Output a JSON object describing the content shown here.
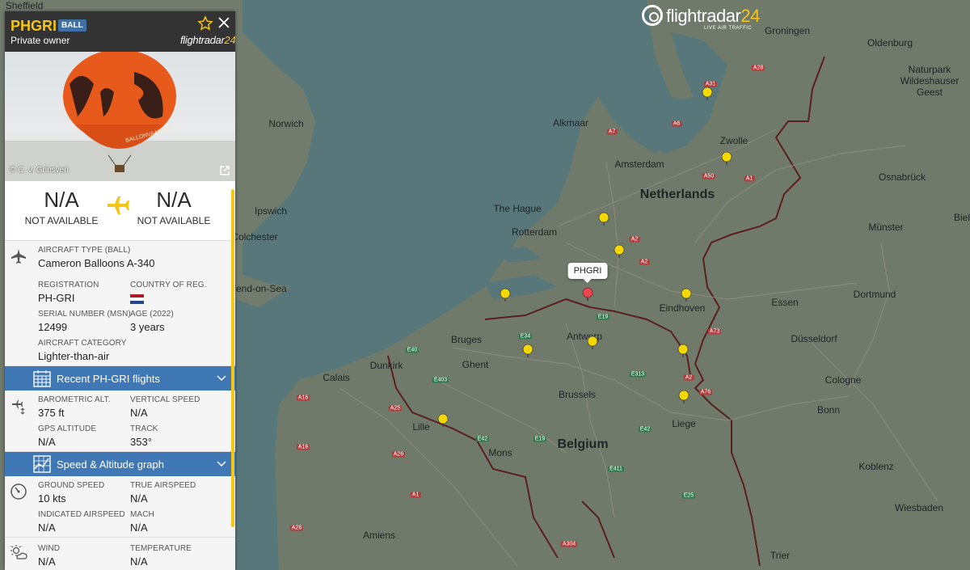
{
  "flight": {
    "callsign": "PHGRI",
    "type_badge": "BALL",
    "owner": "Private owner",
    "brand": "flightradar",
    "brand_num": "24",
    "photo_credit": "© C. v. Grinsven",
    "origin_code": "N/A",
    "origin_name": "NOT AVAILABLE",
    "dest_code": "N/A",
    "dest_name": "NOT AVAILABLE"
  },
  "aircraft": {
    "type_label": "AIRCRAFT TYPE (BALL)",
    "type_value": "Cameron Balloons A-340",
    "reg_label": "REGISTRATION",
    "reg_value": "PH-GRI",
    "country_label": "COUNTRY OF REG.",
    "serial_label": "SERIAL NUMBER (MSN)",
    "serial_value": "12499",
    "age_label": "AGE (2022)",
    "age_value": "3 years",
    "category_label": "AIRCRAFT CATEGORY",
    "category_value": "Lighter-than-air"
  },
  "recent_flights_bar": "Recent PH-GRI flights",
  "altitude": {
    "baro_label": "BAROMETRIC ALT.",
    "baro_value": "375 ft",
    "vspeed_label": "VERTICAL SPEED",
    "vspeed_value": "N/A",
    "gps_label": "GPS ALTITUDE",
    "gps_value": "N/A",
    "track_label": "TRACK",
    "track_value": "353°"
  },
  "speed_graph_bar": "Speed & Altitude graph",
  "speed": {
    "ground_label": "GROUND SPEED",
    "ground_value": "10 kts",
    "tas_label": "TRUE AIRSPEED",
    "tas_value": "N/A",
    "ias_label": "INDICATED AIRSPEED",
    "ias_value": "N/A",
    "mach_label": "MACH",
    "mach_value": "N/A"
  },
  "weather": {
    "wind_label": "WIND",
    "wind_value": "N/A",
    "temp_label": "TEMPERATURE",
    "temp_value": "N/A"
  },
  "logo": {
    "word": "flightradar",
    "num": "24",
    "sub": "LIVE AIR TRAFFIC"
  },
  "map": {
    "selected_label": "PHGRI",
    "countries": [
      "Netherlands",
      "Belgium"
    ],
    "cities": [
      "Sheffield",
      "Norwich",
      "Ipswich",
      "Colchester",
      "hend-on-Sea",
      "Calais",
      "Dunkirk",
      "Lille",
      "Bruges",
      "Ghent",
      "Antwerp",
      "Brussels",
      "Mons",
      "Amiens",
      "Liege",
      "Eindhoven",
      "The Hague",
      "Rotterdam",
      "Amsterdam",
      "Alkmaar",
      "Zwolle",
      "Groningen",
      "Oldenburg",
      "Osnabrück",
      "Münster",
      "Dortmund",
      "Essen",
      "Düsseldorf",
      "Cologne",
      "Bonn",
      "Koblenz",
      "Wiesbaden",
      "Trier",
      "Naturpark Wildeshauser Geest",
      "Biel"
    ],
    "roads": [
      "A31",
      "A28",
      "A7",
      "A6",
      "A1",
      "A50",
      "A2",
      "A2",
      "E34",
      "E19",
      "E40",
      "E313",
      "E403",
      "A2",
      "A76",
      "A25",
      "A16",
      "E42",
      "E19",
      "A26",
      "A1",
      "E411",
      "A28",
      "E25",
      "A304",
      "A16",
      "A73",
      "E42"
    ]
  },
  "icons": {
    "star": "star-icon",
    "close": "close-icon",
    "external": "external-link-icon",
    "plane": "plane-icon",
    "calendar": "calendar-icon",
    "altitude": "altitude-icon",
    "graph": "graph-icon",
    "speedometer": "speedometer-icon",
    "weather": "weather-icon"
  },
  "colors": {
    "accent": "#f5c518",
    "bar": "#3f78b5",
    "header": "#333333"
  }
}
